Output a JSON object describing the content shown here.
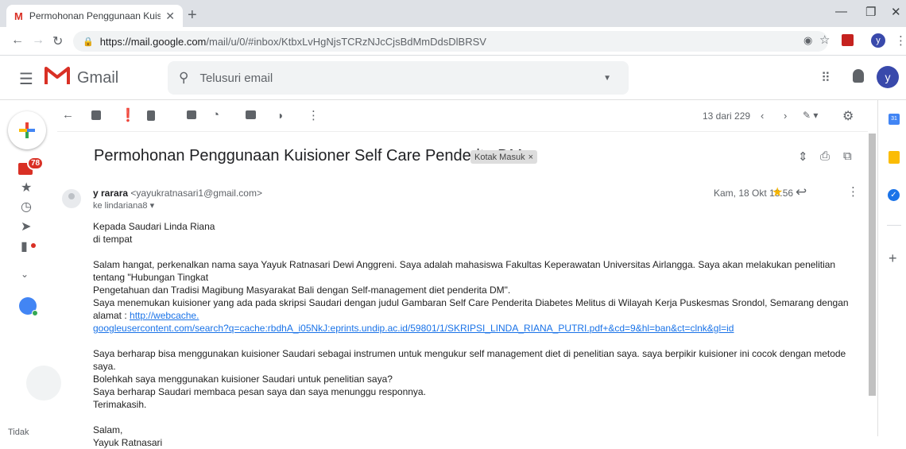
{
  "browser": {
    "tab_title": "Permohonan Penggunaan Kuisio",
    "tab_icon": "M",
    "url_host": "https://mail.google.com",
    "url_path": "/mail/u/0/#inbox/KtbxLvHgNjsTCRzNJcCjsBdMmDdsDlBRSV",
    "profile_initial": "y"
  },
  "header": {
    "logo_text": "Gmail",
    "search_placeholder": "Telusuri email",
    "avatar_initial": "y"
  },
  "rail": {
    "inbox_count": "78",
    "footer_text": "Tidak"
  },
  "toolbar": {
    "page_info": "13 dari 229"
  },
  "message": {
    "subject": "Permohonan Penggunaan Kuisioner Self Care Penderita DM",
    "label": "Kotak Masuk",
    "label_remove": "×",
    "sender_name": "y rarara",
    "sender_email": "<yayukratnasari1@gmail.com>",
    "to": "ke lindariana8",
    "date": "Kam, 18 Okt 13.56",
    "body": {
      "greeting_1": "Kepada Saudari Linda Riana",
      "greeting_2": "di tempat",
      "para1_line1": "Salam hangat, perkenalkan nama saya Yayuk Ratnasari Dewi Anggreni. Saya adalah mahasiswa Fakultas Keperawatan Universitas Airlangga. Saya akan melakukan penelitian tentang \"Hubungan Tingkat",
      "para1_line2": "Pengetahuan dan Tradisi Magibung Masyarakat Bali dengan Self-management diet penderita DM\".",
      "para1_line3": "Saya menemukan kuisioner yang ada pada skripsi Saudari dengan judul Gambaran Self Care Penderita Diabetes Melitus di Wilayah Kerja Puskesmas Srondol, Semarang dengan alamat : ",
      "link_part1": "http://webcache.",
      "link_part2": "googleusercontent.com/search?q=cache:rbdhA_i05NkJ:eprints.undip.ac.id/59801/1/SKRIPSI_LINDA_RIANA_PUTRI.pdf+&cd=9&hl=ban&ct=clnk&gl=id",
      "para2_line1": "Saya berharap bisa menggunakan kuisioner Saudari sebagai instrumen untuk mengukur self management diet di penelitian saya. saya berpikir kuisioner ini cocok dengan metode saya.",
      "para2_line2": "Bolehkah saya menggunakan kuisioner Saudari untuk penelitian saya?",
      "para2_line3": "Saya berharap Saudari membaca pesan saya dan saya menunggu responnya.",
      "para2_line4": "Terimakasih.",
      "closing_1": "Salam,",
      "closing_2": "Yayuk Ratnasari"
    }
  },
  "colors": {
    "accent_red": "#d93025",
    "link_blue": "#1a73e8",
    "star_yellow": "#f4b400"
  }
}
